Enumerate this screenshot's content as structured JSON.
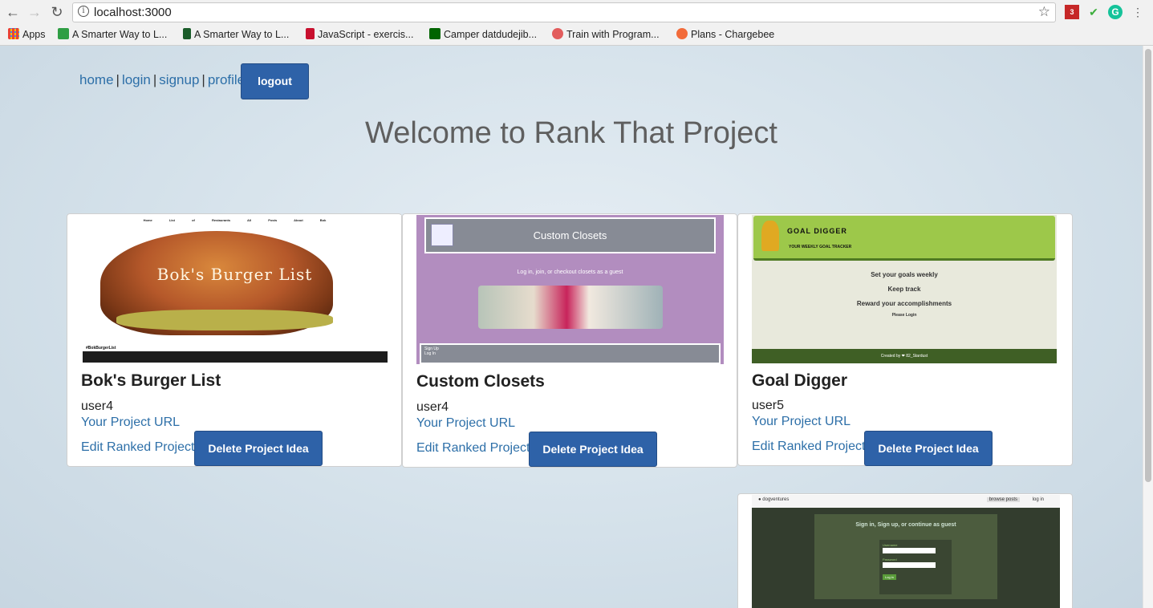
{
  "browser": {
    "url_host": "localhost:3000",
    "bookmarks": [
      {
        "label": "Apps",
        "color": "#e94235"
      },
      {
        "label": "A Smarter Way to L...",
        "color": "#2f9e44"
      },
      {
        "label": "A Smarter Way to L...",
        "color": "#1a5c2a"
      },
      {
        "label": "JavaScript - exercis...",
        "color": "#c8102e"
      },
      {
        "label": "Camper datdudejib...",
        "color": "#006400"
      },
      {
        "label": "Train with Program...",
        "color": "#e25c5c"
      },
      {
        "label": "Plans - Chargebee",
        "color": "#f26b3a"
      }
    ],
    "extension_badge": "3"
  },
  "nav": {
    "home": "home",
    "login": "login",
    "signup": "signup",
    "profile": "profile",
    "separator": "|",
    "logout": "logout"
  },
  "welcome": "Welcome to Rank That Project",
  "projects": [
    {
      "title": "Bok's Burger List",
      "user": "user4",
      "url_label": "Your Project URL",
      "edit_label": "Edit Ranked Project",
      "delete_label": "Delete Project Idea",
      "thumb": {
        "nav": "Home List of Restaurants All Posts About Bok",
        "banner": "Bok's Burger List",
        "footer": "#BokBurgerList"
      }
    },
    {
      "title": "Custom Closets",
      "user": "user4",
      "url_label": "Your Project URL",
      "edit_label": "Edit Ranked Project",
      "delete_label": "Delete Project Idea",
      "thumb": {
        "header": "Custom Closets",
        "subtitle": "Log in, join, or checkout closets as a guest",
        "form_signup": "Sign Up",
        "form_login": "Log In"
      }
    },
    {
      "title": "Goal Digger",
      "user": "user5",
      "url_label": "Your Project URL",
      "edit_label": "Edit Ranked Project",
      "delete_label": "Delete Project Idea",
      "thumb": {
        "brand": "GOAL DIGGER",
        "tagline": "YOUR WEEKLY GOAL TRACKER",
        "line1": "Set your goals weekly",
        "line2": "Keep track",
        "line3": "Reward your accomplishments",
        "line4": "Please Login",
        "footer": "Created by ❤ 82_Stardust"
      }
    },
    {
      "thumb": {
        "brand": "dogventures",
        "nav1": "browse posts",
        "nav2": "log in",
        "title": "Sign in, Sign up, or continue as guest",
        "user_label": "Username",
        "pass_label": "Password",
        "login_btn": "Log in"
      }
    }
  ]
}
